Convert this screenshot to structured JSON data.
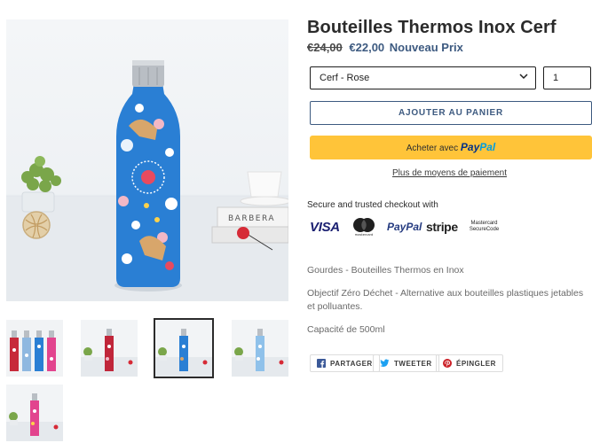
{
  "product": {
    "title": "Bouteilles Thermos Inox Cerf",
    "old_price": "€24,00",
    "new_price": "€22,00",
    "new_price_label": "Nouveau Prix"
  },
  "form": {
    "variant_selected": "Cerf - Rose",
    "quantity": "1",
    "add_to_cart_label": "AJOUTER AU PANIER",
    "paypal_prefix": "Acheter avec",
    "paypal_brand_1": "Pay",
    "paypal_brand_2": "Pal",
    "more_payment_label": "Plus de moyens de paiement"
  },
  "checkout": {
    "secure_text": "Secure and trusted checkout with",
    "badges": [
      {
        "name": "VISA",
        "icon": "visa-icon"
      },
      {
        "name": "mastercard",
        "icon": "mastercard-icon"
      },
      {
        "name": "PayPal",
        "icon": "paypal-icon"
      },
      {
        "name": "stripe",
        "icon": "stripe-icon"
      },
      {
        "name": "Mastercard SecureCode",
        "line1": "Mastercard",
        "line2": "SecureCode",
        "icon": "mastercard-securecode-icon"
      }
    ]
  },
  "description": {
    "line1": "Gourdes - Bouteilles Thermos en Inox",
    "line2": "Objectif Zéro Déchet - Alternative aux bouteilles plastiques jetables et polluantes.",
    "line3": "Capacité de 500ml"
  },
  "share": {
    "facebook_label": "PARTAGER",
    "twitter_label": "TWEETER",
    "pinterest_label": "ÉPINGLER"
  },
  "gallery": {
    "main_image": "blue-deer-thermos-bottle-photo",
    "book_text": "BARBERA",
    "thumbnails": [
      {
        "image": "four-bottles-photo",
        "active": false
      },
      {
        "image": "red-bottle-photo",
        "active": false
      },
      {
        "image": "blue-deer-bottle-photo",
        "active": true
      },
      {
        "image": "light-blue-bottle-photo",
        "active": false
      },
      {
        "image": "pink-bottle-photo",
        "active": false
      }
    ]
  },
  "colors": {
    "accent": "#3d5a80",
    "paypal_yellow": "#ffc439",
    "bottle_blue": "#2a7fd4"
  }
}
